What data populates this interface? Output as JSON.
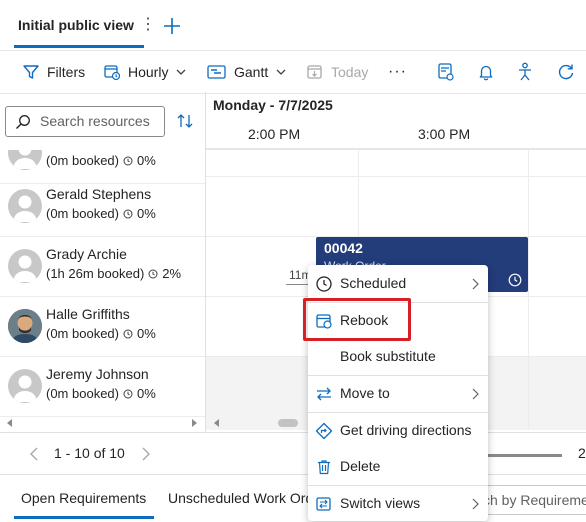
{
  "tabbar": {
    "active_tab": "Initial public view",
    "more_icon": "more-vertical-icon",
    "add_icon": "plus-icon"
  },
  "toolbar": {
    "filters_label": "Filters",
    "hourly_label": "Hourly",
    "gantt_label": "Gantt",
    "today_label": "Today",
    "more_label": "···",
    "icons": [
      "filter-icon",
      "calendar-clock-icon",
      "gantt-icon",
      "calendar-today-icon",
      "map-icon",
      "bell-icon",
      "person-accessibility-icon",
      "refresh-icon"
    ]
  },
  "resource_panel": {
    "search_placeholder": "Search resources",
    "resources": [
      {
        "name": "",
        "meta": "(0m booked)",
        "percent": "0%",
        "avatar": "placeholder"
      },
      {
        "name": "Gerald Stephens",
        "meta": "(0m booked)",
        "percent": "0%",
        "avatar": "placeholder"
      },
      {
        "name": "Grady Archie",
        "meta": "(1h 26m booked)",
        "percent": "2%",
        "avatar": "placeholder"
      },
      {
        "name": "Halle Griffiths",
        "meta": "(0m booked)",
        "percent": "0%",
        "avatar": "photo"
      },
      {
        "name": "Jeremy Johnson",
        "meta": "(0m booked)",
        "percent": "0%",
        "avatar": "placeholder"
      }
    ]
  },
  "schedule": {
    "date_label": "Monday - 7/7/2025",
    "times": [
      "2:00 PM",
      "3:00 PM"
    ],
    "booking": {
      "id": "00042",
      "subtitle": "Work Order",
      "color": "#233c7a"
    },
    "travel_label": "11m"
  },
  "paging": {
    "range": "1 - 10 of 10",
    "zoom_value": "2"
  },
  "bottom_tabs": {
    "open": "Open Requirements",
    "unscheduled": "Unscheduled Work Orders",
    "search_placeholder": "ch by Requireme"
  },
  "context_menu": {
    "items": [
      {
        "label": "Scheduled",
        "icon": "clock-icon",
        "submenu": true
      },
      {
        "label": "Rebook",
        "icon": "calendar-rebook-icon",
        "submenu": false
      },
      {
        "label": "Book substitute",
        "icon": "",
        "submenu": false
      },
      {
        "label": "Move to",
        "icon": "arrows-swap-icon",
        "submenu": true
      },
      {
        "label": "Get driving directions",
        "icon": "directions-icon",
        "submenu": false
      },
      {
        "label": "Delete",
        "icon": "trash-icon",
        "submenu": false
      },
      {
        "label": "Switch views",
        "icon": "switch-views-icon",
        "submenu": true
      }
    ],
    "highlight_color": "#d91f26"
  },
  "colors": {
    "accent": "#0f6cbd",
    "booking": "#233c7a",
    "highlight": "#d91f26"
  }
}
